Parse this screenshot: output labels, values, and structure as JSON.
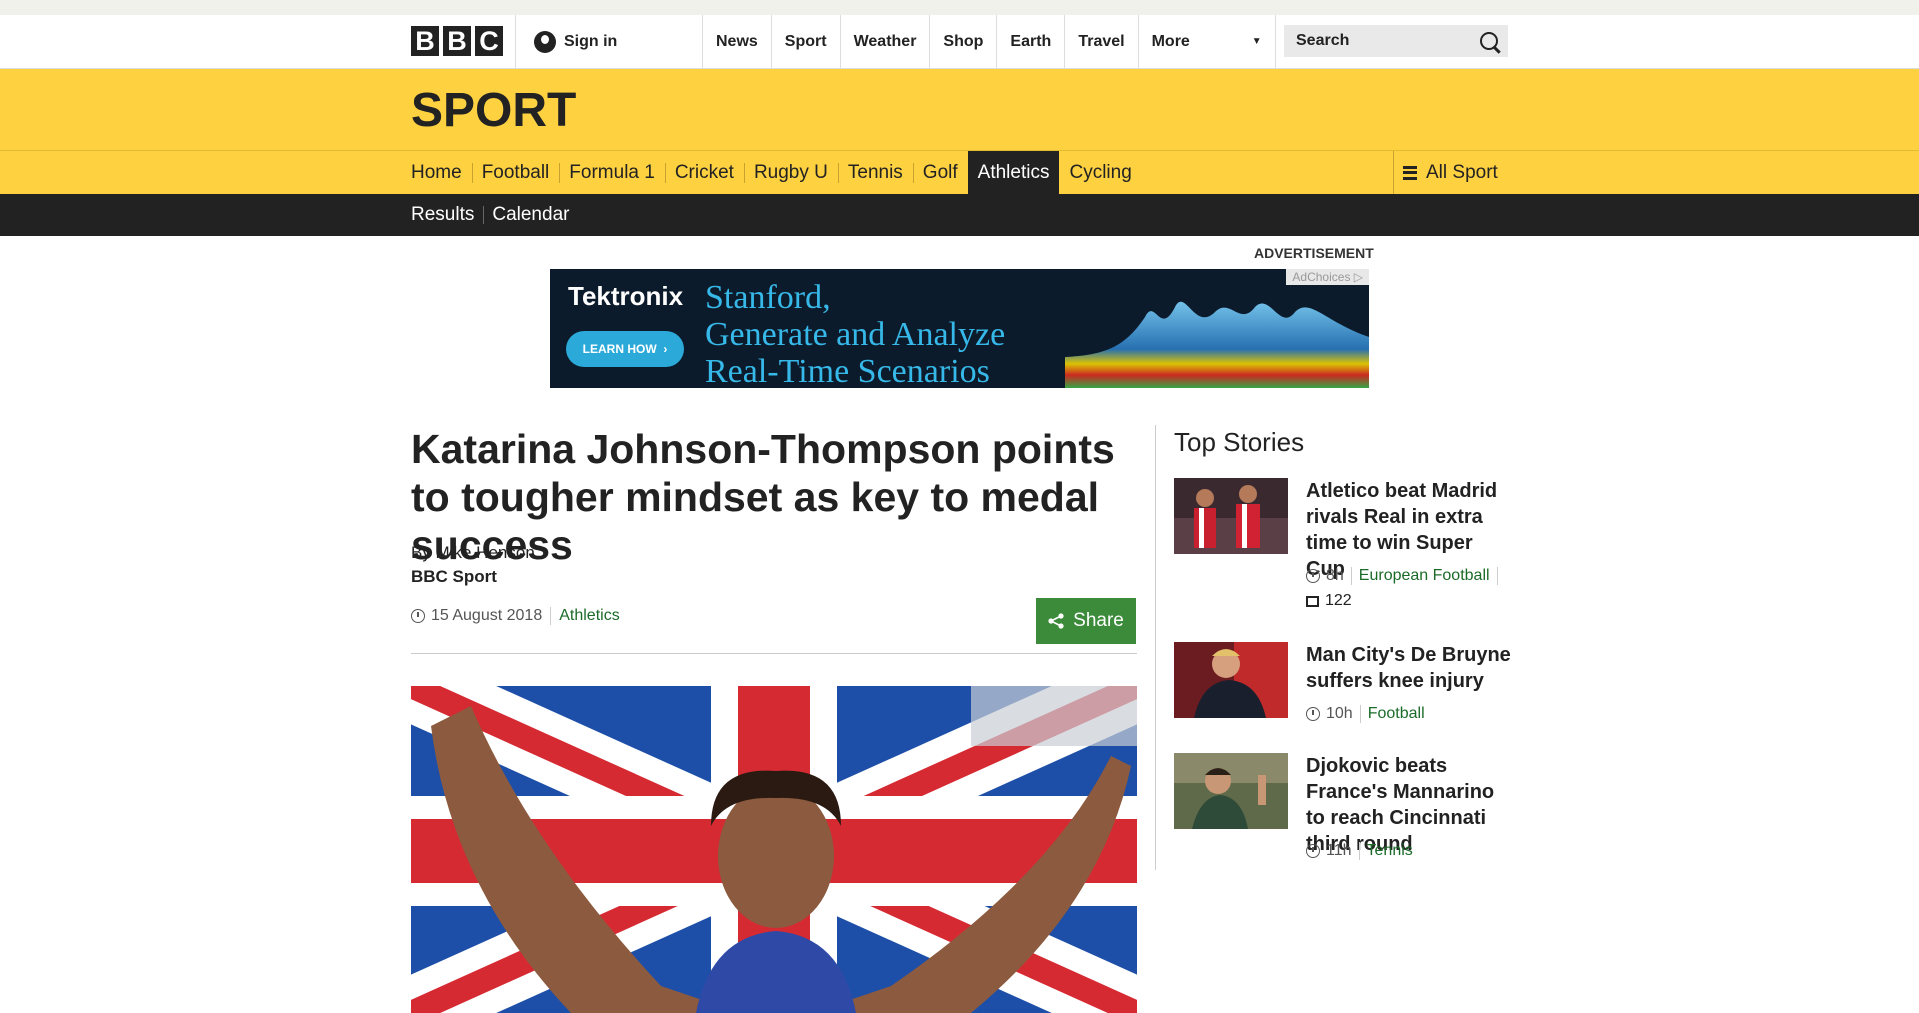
{
  "global_header": {
    "logo_letters": [
      "B",
      "B",
      "C"
    ],
    "sign_in": "Sign in",
    "nav": [
      "News",
      "Sport",
      "Weather",
      "Shop",
      "Earth",
      "Travel",
      "More"
    ],
    "search_placeholder": "Search"
  },
  "section": {
    "title": "SPORT",
    "nav": [
      "Home",
      "Football",
      "Formula 1",
      "Cricket",
      "Rugby U",
      "Tennis",
      "Golf",
      "Athletics",
      "Cycling"
    ],
    "active": "Athletics",
    "all_sport": "All Sport",
    "subnav": [
      "Results",
      "Calendar"
    ]
  },
  "ad": {
    "label": "ADVERTISEMENT",
    "brand": "Tektronix",
    "cta": "LEARN HOW",
    "copy_lines": [
      "Stanford,",
      "Generate and Analyze",
      "Real-Time Scenarios"
    ],
    "adchoices": "AdChoices"
  },
  "article": {
    "headline": "Katarina Johnson-Thompson points to tougher mindset as key to medal success",
    "byline": "By Mike Henson",
    "organisation": "BBC Sport",
    "date": "15 August 2018",
    "topic": "Athletics",
    "share": "Share"
  },
  "sidebar": {
    "title": "Top Stories",
    "stories": [
      {
        "title": "Atletico beat Madrid rivals Real in extra time to win Super Cup",
        "time": "8h",
        "topic": "European Football",
        "comments": "122"
      },
      {
        "title": "Man City's De Bruyne suffers knee injury",
        "time": "10h",
        "topic": "Football"
      },
      {
        "title": "Djokovic beats France's Mannarino to reach Cincinnati third round",
        "time": "11h",
        "topic": "Tennis"
      }
    ]
  },
  "colors": {
    "sport_yellow": "#fed141",
    "dark": "#222222",
    "green": "#3c8b3a",
    "link_green": "#1b6b28"
  }
}
